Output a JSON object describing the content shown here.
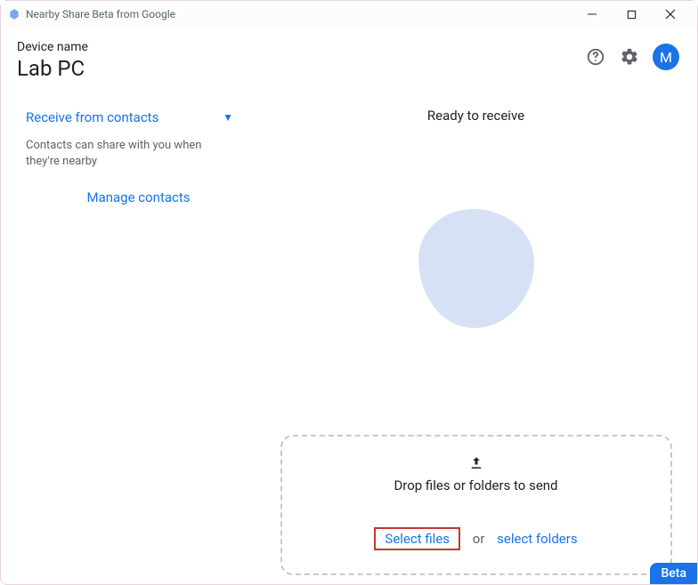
{
  "titlebar": {
    "title": "Nearby Share Beta from Google"
  },
  "header": {
    "device_label": "Device name",
    "device_name": "Lab PC",
    "avatar_initial": "M"
  },
  "sidebar": {
    "receive_label": "Receive from contacts",
    "help_text": "Contacts can share with you when they're nearby",
    "manage_label": "Manage contacts"
  },
  "main": {
    "ready_text": "Ready to receive",
    "drop_text": "Drop files or folders to send",
    "select_files_label": "Select files",
    "or_label": "or",
    "select_folders_label": "select folders"
  },
  "badge": {
    "beta": "Beta"
  }
}
